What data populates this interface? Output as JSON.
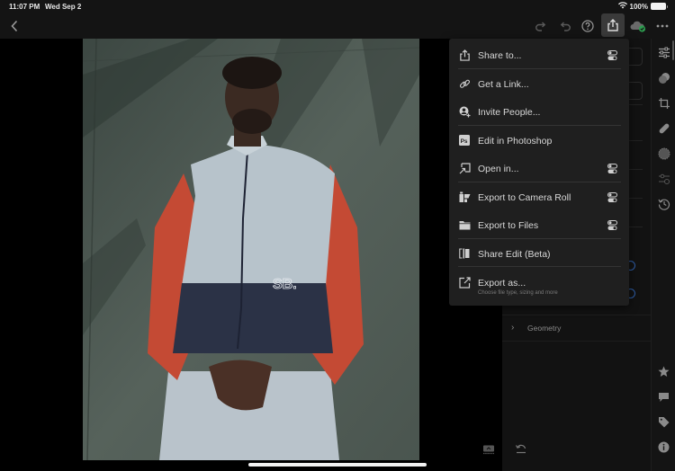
{
  "status_bar": {
    "time": "11:07 PM",
    "date": "Wed Sep 2",
    "battery_percent": "100%",
    "wifi_icon": "wifi-icon",
    "battery_icon": "battery-icon"
  },
  "toolbar": {
    "back_icon": "chevron-left-icon",
    "redo_icon": "redo-icon",
    "undo_icon": "undo-icon",
    "help_icon": "question-circle-icon",
    "share_icon": "share-icon",
    "cloud_icon": "cloud-synced-icon",
    "more_icon": "more-horizontal-icon",
    "share_active": true,
    "sync_status_color": "#2d9c4f"
  },
  "photo": {
    "description": "Portrait of man in grey, red and navy windbreaker with SB. logo against concrete wall",
    "jacket_logo": "SB."
  },
  "share_menu": {
    "items": [
      {
        "label": "Share to...",
        "icon": "share-icon",
        "has_settings_toggle": true
      },
      {
        "label": "Get a Link...",
        "icon": "link-icon",
        "has_settings_toggle": false
      },
      {
        "label": "Invite People...",
        "icon": "invite-person-icon",
        "has_settings_toggle": false
      },
      {
        "label": "Edit in Photoshop",
        "icon": "photoshop-icon",
        "has_settings_toggle": false
      },
      {
        "label": "Open in...",
        "icon": "open-in-icon",
        "has_settings_toggle": true
      },
      {
        "label": "Export to Camera Roll",
        "icon": "camera-roll-icon",
        "has_settings_toggle": true
      },
      {
        "label": "Export to Files",
        "icon": "folder-icon",
        "has_settings_toggle": true
      },
      {
        "label": "Share Edit (Beta)",
        "icon": "share-edit-icon",
        "has_settings_toggle": false
      },
      {
        "label": "Export as...",
        "sublabel": "Choose file type, sizing and more",
        "icon": "export-as-icon",
        "has_settings_toggle": false
      }
    ]
  },
  "edit_panel": {
    "geometry_label": "Geometry",
    "reset_icon": "reset-icon",
    "accent_color": "#2f5ea8"
  },
  "icon_rail": {
    "top": [
      "edit-sliders-icon",
      "presets-icon",
      "crop-icon",
      "healing-icon",
      "masking-icon",
      "versions-icon",
      "history-icon"
    ],
    "bottom": [
      "star-icon",
      "comment-icon",
      "tag-icon",
      "info-icon"
    ]
  },
  "stage": {
    "filmstrip_icon": "show-filmstrip-icon"
  }
}
